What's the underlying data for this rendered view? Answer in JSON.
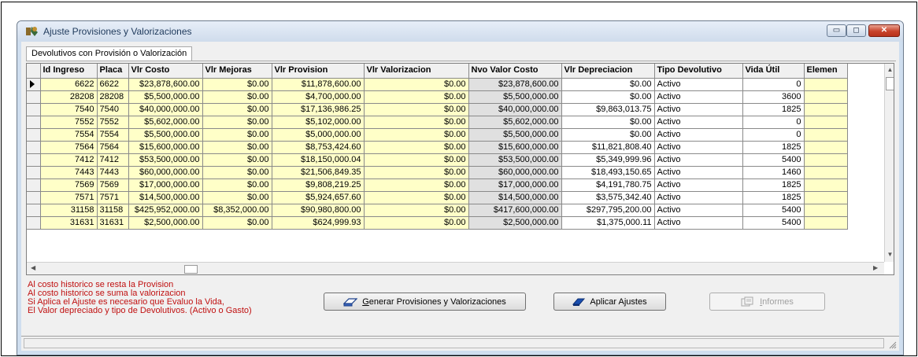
{
  "window": {
    "title": "Ajuste Provisiones y Valorizaciones",
    "minimize_symbol": "▭",
    "maximize_symbol": "◻",
    "close_symbol": "✕"
  },
  "tab": {
    "label": "Devolutivos con Provisión o Valorización"
  },
  "grid": {
    "columns": [
      "Id Ingreso",
      "Placa",
      "Vlr Costo",
      "Vlr Mejoras",
      "Vlr Provision",
      "Vlr Valorizacion",
      "Nvo Valor Costo",
      "Vlr Depreciacion",
      "Tipo Devolutivo",
      "Vida Útil",
      "Elemen"
    ],
    "rows": [
      [
        "6622",
        "6622",
        "$23,878,600.00",
        "$0.00",
        "$11,878,600.00",
        "$0.00",
        "$23,878,600.00",
        "$0.00",
        "Activo",
        "0",
        ""
      ],
      [
        "28208",
        "28208",
        "$5,500,000.00",
        "$0.00",
        "$4,700,000.00",
        "$0.00",
        "$5,500,000.00",
        "$0.00",
        "Activo",
        "3600",
        ""
      ],
      [
        "7540",
        "7540",
        "$40,000,000.00",
        "$0.00",
        "$17,136,986.25",
        "$0.00",
        "$40,000,000.00",
        "$9,863,013.75",
        "Activo",
        "1825",
        ""
      ],
      [
        "7552",
        "7552",
        "$5,602,000.00",
        "$0.00",
        "$5,102,000.00",
        "$0.00",
        "$5,602,000.00",
        "$0.00",
        "Activo",
        "0",
        ""
      ],
      [
        "7554",
        "7554",
        "$5,500,000.00",
        "$0.00",
        "$5,000,000.00",
        "$0.00",
        "$5,500,000.00",
        "$0.00",
        "Activo",
        "0",
        ""
      ],
      [
        "7564",
        "7564",
        "$15,600,000.00",
        "$0.00",
        "$8,753,424.60",
        "$0.00",
        "$15,600,000.00",
        "$11,821,808.40",
        "Activo",
        "1825",
        ""
      ],
      [
        "7412",
        "7412",
        "$53,500,000.00",
        "$0.00",
        "$18,150,000.04",
        "$0.00",
        "$53,500,000.00",
        "$5,349,999.96",
        "Activo",
        "5400",
        ""
      ],
      [
        "7443",
        "7443",
        "$60,000,000.00",
        "$0.00",
        "$21,506,849.35",
        "$0.00",
        "$60,000,000.00",
        "$18,493,150.65",
        "Activo",
        "1460",
        ""
      ],
      [
        "7569",
        "7569",
        "$17,000,000.00",
        "$0.00",
        "$9,808,219.25",
        "$0.00",
        "$17,000,000.00",
        "$4,191,780.75",
        "Activo",
        "1825",
        ""
      ],
      [
        "7571",
        "7571",
        "$14,500,000.00",
        "$0.00",
        "$5,924,657.60",
        "$0.00",
        "$14,500,000.00",
        "$3,575,342.40",
        "Activo",
        "1825",
        ""
      ],
      [
        "31158",
        "31158",
        "$425,952,000.00",
        "$8,352,000.00",
        "$90,980,800.00",
        "$0.00",
        "$417,600,000.00",
        "$297,795,200.00",
        "Activo",
        "5400",
        ""
      ],
      [
        "31631",
        "31631",
        "$2,500,000.00",
        "$0.00",
        "$624,999.93",
        "$0.00",
        "$2,500,000.00",
        "$1,375,000.11",
        "Activo",
        "5400",
        ""
      ]
    ]
  },
  "notes": [
    "Al costo historico se resta la Provision",
    "Al costo historico se suma la valorizacion",
    "Si Aplica el Ajuste es necesario que Evaluo la Vida,",
    "El Valor depreciado y tipo de Devolutivos. (Activo o Gasto)"
  ],
  "buttons": {
    "generar": {
      "underline": "G",
      "rest": "enerar Provisiones y Valorizaciones"
    },
    "aplicar": "Aplicar Ajustes",
    "informes": {
      "underline": "I",
      "rest": "nformes"
    }
  },
  "colors": {
    "cell_yellow": "#ffffc8",
    "cell_gray": "#e0e0e0",
    "notes_red": "#c01010",
    "titlebar": "#cfdeef"
  }
}
